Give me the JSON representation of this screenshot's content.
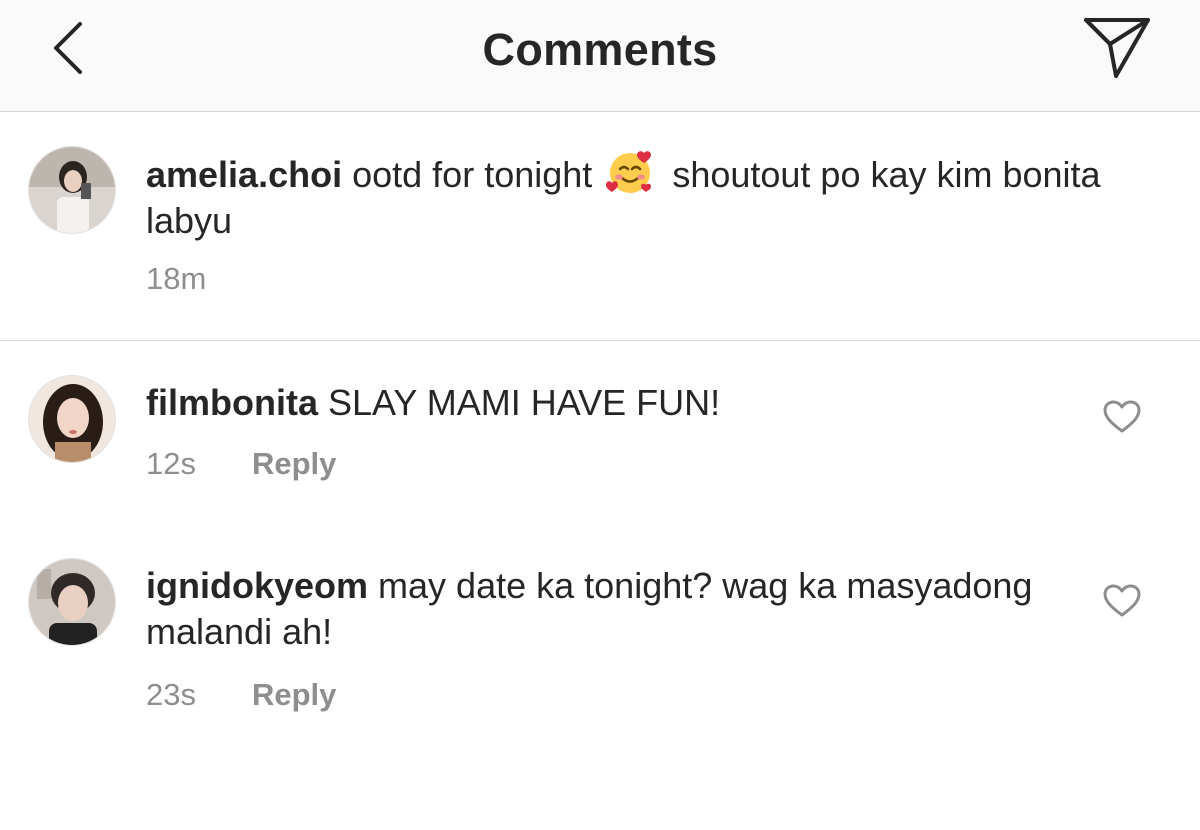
{
  "header": {
    "title": "Comments",
    "back_icon": "chevron-left-icon",
    "share_icon": "paper-plane-icon"
  },
  "caption": {
    "username": "amelia.choi",
    "text_before_emoji": "ootd for tonight",
    "emoji": "smiling-face-with-hearts",
    "text_after_emoji": "shoutout po kay kim bonita labyu",
    "time": "18m"
  },
  "comments": [
    {
      "username": "filmbonita",
      "text": "SLAY MAMI HAVE FUN!",
      "time": "12s",
      "reply_label": "Reply",
      "like_icon": "heart-outline-icon"
    },
    {
      "username": "ignidokyeom",
      "text": "may date ka tonight? wag ka masyadong malandi ah!",
      "time": "23s",
      "reply_label": "Reply",
      "like_icon": "heart-outline-icon"
    }
  ],
  "colors": {
    "text": "#262626",
    "secondary": "#8e8e8e",
    "header_bg": "#fafafa",
    "divider": "#dbdbdb"
  }
}
